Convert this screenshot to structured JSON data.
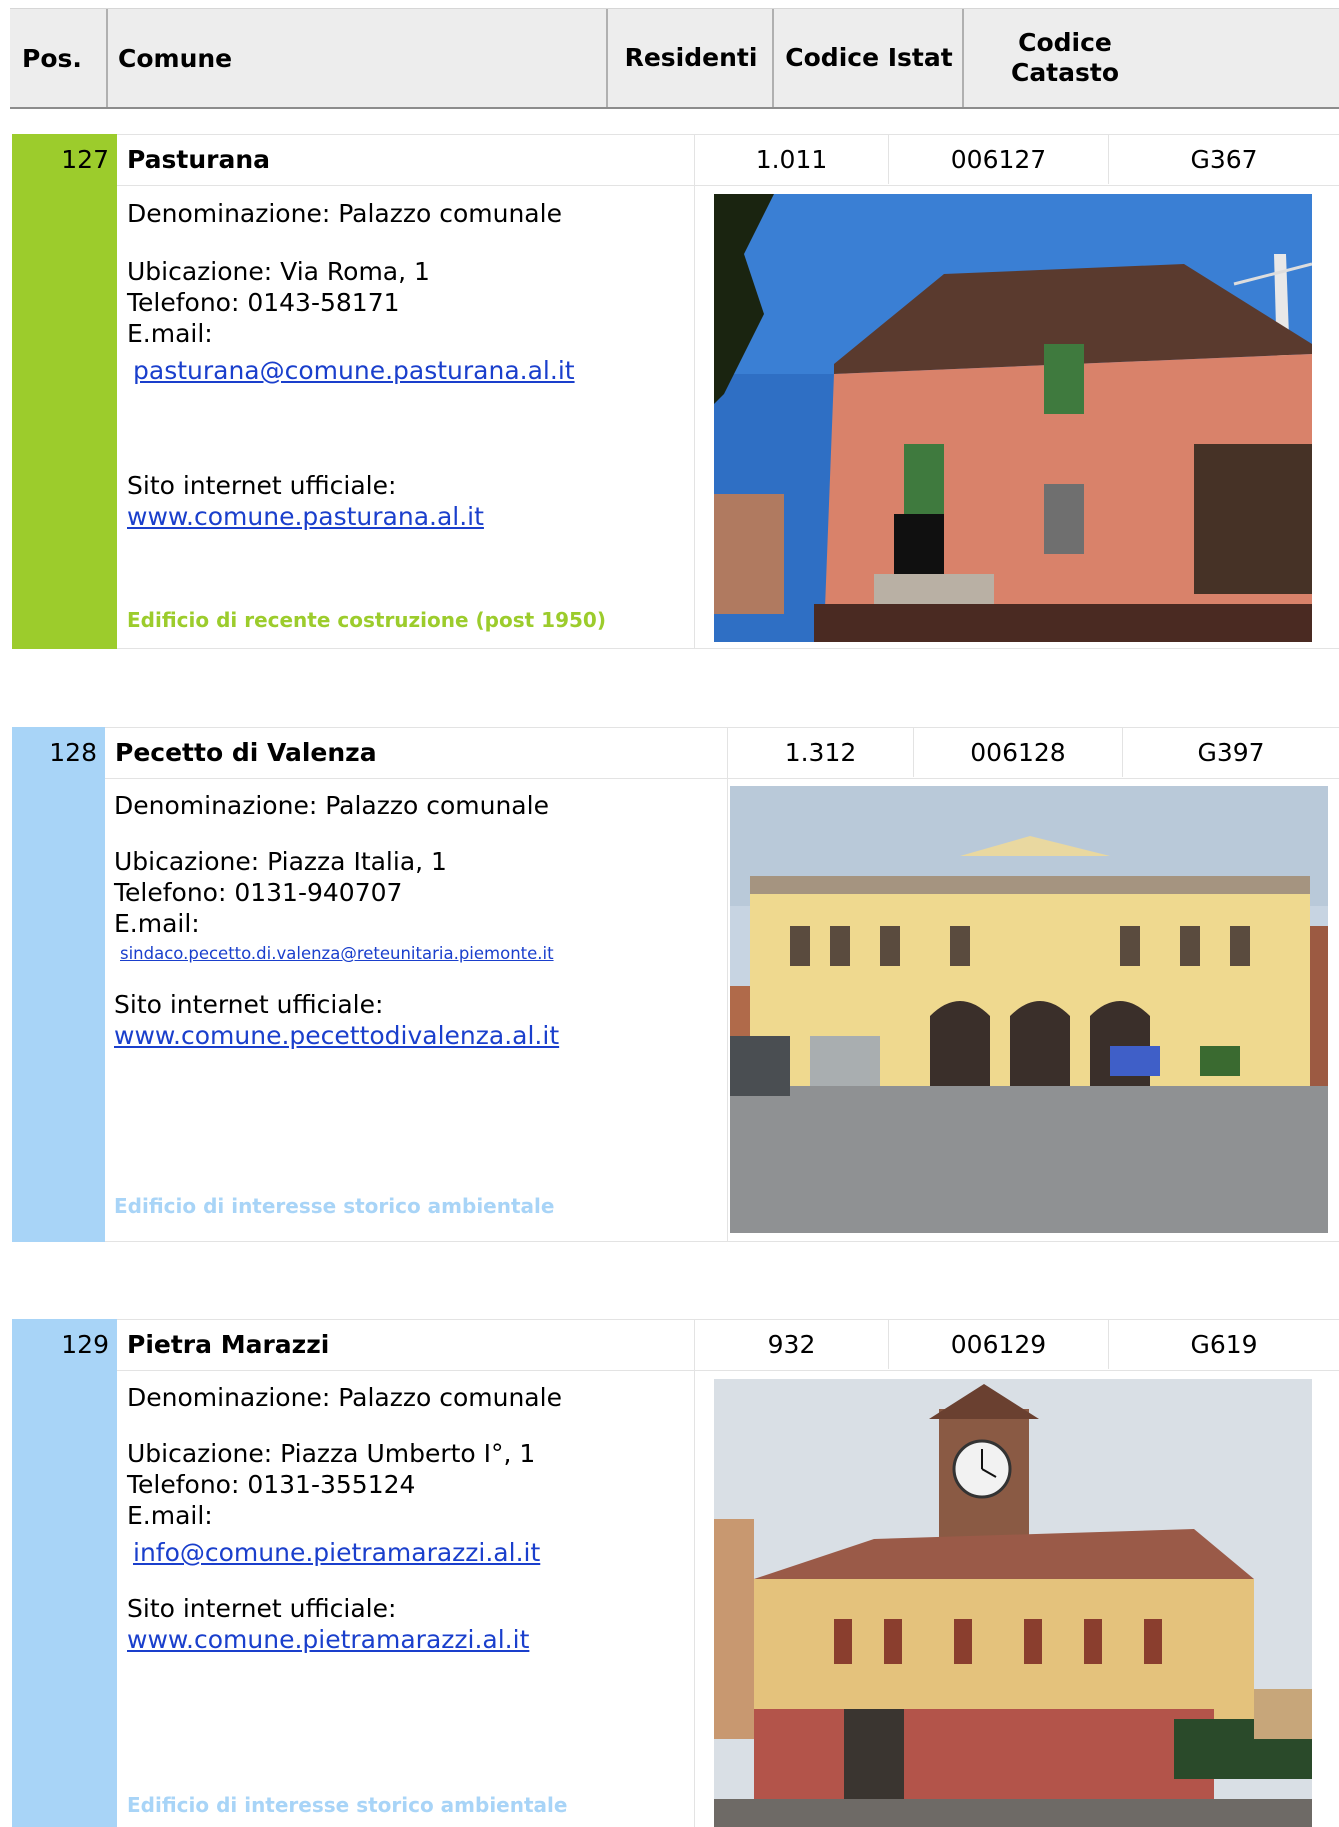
{
  "header": {
    "pos": "Pos.",
    "comune": "Comune",
    "residenti": "Residenti",
    "codice_istat": "Codice Istat",
    "codice_catasto": "Codice Catasto"
  },
  "entries": [
    {
      "pos": "127",
      "name": "Pasturana",
      "residenti": "1.011",
      "istat": "006127",
      "catasto": "G367",
      "denominazione": "Denominazione: Palazzo comunale",
      "ubicazione": "Ubicazione: Via Roma, 1",
      "telefono": "Telefono: 0143-58171",
      "email_label": "E.mail:",
      "email": "pasturana@comune.pasturana.al.it",
      "sito_label": "Sito internet ufficiale:",
      "sito": "www.comune.pasturana.al.it",
      "note": "Edificio di recente costruzione (post 1950)",
      "color": "#9ccc2c"
    },
    {
      "pos": "128",
      "name": "Pecetto di Valenza",
      "residenti": "1.312",
      "istat": "006128",
      "catasto": "G397",
      "denominazione": "Denominazione: Palazzo comunale",
      "ubicazione": "Ubicazione: Piazza Italia, 1",
      "telefono": "Telefono: 0131-940707",
      "email_label": "E.mail:",
      "email": "sindaco.pecetto.di.valenza@reteunitaria.piemonte.it",
      "sito_label": "Sito internet ufficiale:",
      "sito": "www.comune.pecettodivalenza.al.it",
      "note": "Edificio di interesse storico ambientale",
      "color": "#a8d4f7"
    },
    {
      "pos": "129",
      "name": "Pietra Marazzi",
      "residenti": "932",
      "istat": "006129",
      "catasto": "G619",
      "denominazione": "Denominazione: Palazzo comunale",
      "ubicazione": "Ubicazione: Piazza Umberto I°, 1",
      "telefono": "Telefono: 0131-355124",
      "email_label": "E.mail:",
      "email": "info@comune.pietramarazzi.al.it",
      "sito_label": "Sito internet ufficiale:",
      "sito": "www.comune.pietramarazzi.al.it",
      "note": "Edificio di interesse storico ambientale",
      "color": "#a8d4f7"
    }
  ]
}
